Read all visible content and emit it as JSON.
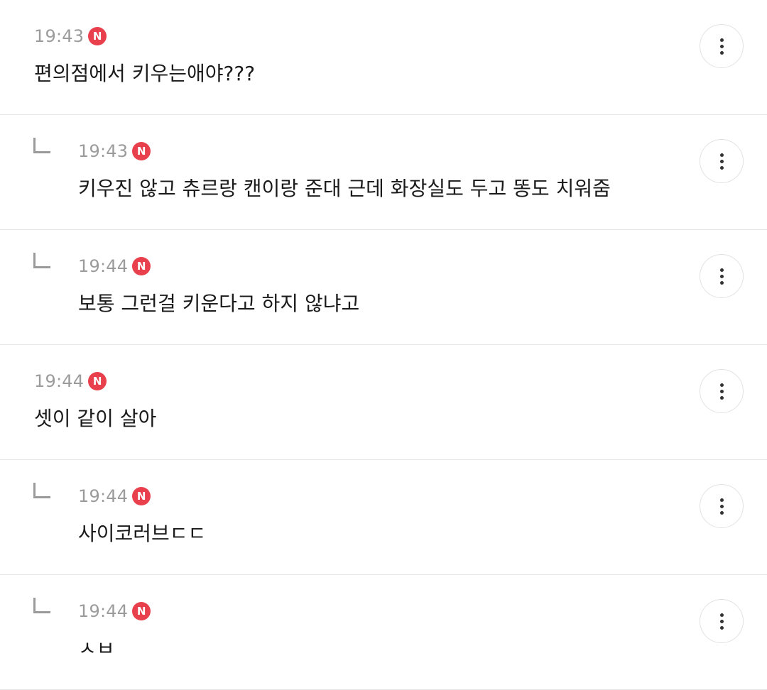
{
  "comments": [
    {
      "time": "19:43",
      "badge": "N",
      "text": "편의점에서 키우는애야???",
      "reply": false
    },
    {
      "time": "19:43",
      "badge": "N",
      "text": "키우진 않고 츄르랑 캔이랑 준대 근데 화장실도 두고 똥도 치워줌",
      "reply": true
    },
    {
      "time": "19:44",
      "badge": "N",
      "text": "보통 그런걸 키운다고 하지 않냐고",
      "reply": true
    },
    {
      "time": "19:44",
      "badge": "N",
      "text": "셋이 같이 살아",
      "reply": false
    },
    {
      "time": "19:44",
      "badge": "N",
      "text": "사이코러브ㄷㄷ",
      "reply": true
    },
    {
      "time": "19:44",
      "badge": "N",
      "text": "ㅅㅂ",
      "reply": true
    }
  ],
  "colors": {
    "badge": "#e8414d",
    "time": "#9b9b9b",
    "text": "#1a1a1a",
    "divider": "#e6e6e6"
  },
  "icons": {
    "reply": "reply-arrow-icon",
    "more": "more-vertical-icon"
  }
}
